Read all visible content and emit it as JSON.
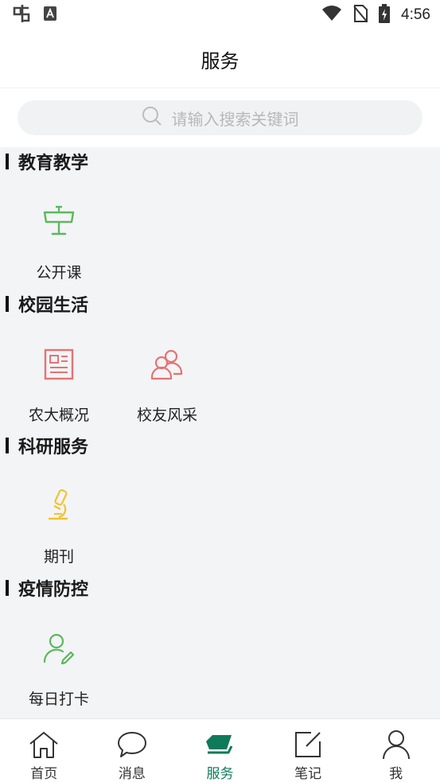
{
  "status_bar": {
    "time": "4:56"
  },
  "header": {
    "title": "服务"
  },
  "search": {
    "placeholder": "请输入搜索关键词"
  },
  "sections": [
    {
      "title": "教育教学",
      "items": [
        {
          "label": "公开课",
          "icon": "podium-icon"
        }
      ]
    },
    {
      "title": "校园生活",
      "items": [
        {
          "label": "农大概况",
          "icon": "newspaper-icon"
        },
        {
          "label": "校友风采",
          "icon": "people-icon"
        }
      ]
    },
    {
      "title": "科研服务",
      "items": [
        {
          "label": "期刊",
          "icon": "microscope-icon"
        }
      ]
    },
    {
      "title": "疫情防控",
      "items": [
        {
          "label": "每日打卡",
          "icon": "user-edit-icon"
        }
      ]
    }
  ],
  "tabs": [
    {
      "label": "首页",
      "icon": "home-icon"
    },
    {
      "label": "消息",
      "icon": "chat-bubble-icon"
    },
    {
      "label": "服务",
      "icon": "layers-icon",
      "active": true
    },
    {
      "label": "笔记",
      "icon": "note-edit-icon"
    },
    {
      "label": "我",
      "icon": "person-icon"
    }
  ],
  "colors": {
    "accent": "#0f7a5a",
    "green_icon": "#5cb85c",
    "red_icon": "#e57373",
    "yellow_icon": "#f2c230"
  }
}
